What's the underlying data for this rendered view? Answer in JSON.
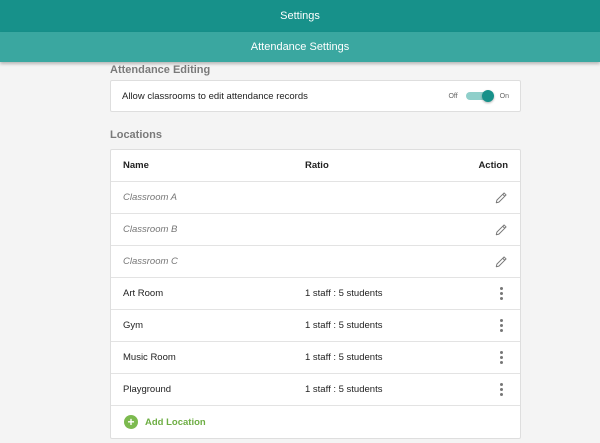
{
  "header": {
    "title": "Settings"
  },
  "subheader": {
    "title": "Attendance Settings"
  },
  "attendance_editing": {
    "section_title": "Attendance Editing",
    "label": "Allow classrooms to edit attendance records",
    "toggle_off_label": "Off",
    "toggle_on_label": "On",
    "enabled": true
  },
  "locations": {
    "section_title": "Locations",
    "columns": {
      "name": "Name",
      "ratio": "Ratio",
      "action": "Action"
    },
    "rows": [
      {
        "name": "Classroom A",
        "ratio": "",
        "action_icon": "pencil-icon"
      },
      {
        "name": "Classroom B",
        "ratio": "",
        "action_icon": "pencil-icon"
      },
      {
        "name": "Classroom C",
        "ratio": "",
        "action_icon": "pencil-icon"
      },
      {
        "name": "Art Room",
        "ratio": "1 staff : 5 students",
        "action_icon": "more-vertical-icon"
      },
      {
        "name": "Gym",
        "ratio": "1 staff : 5 students",
        "action_icon": "more-vertical-icon"
      },
      {
        "name": "Music Room",
        "ratio": "1 staff : 5 students",
        "action_icon": "more-vertical-icon"
      },
      {
        "name": "Playground",
        "ratio": "1 staff : 5 students",
        "action_icon": "more-vertical-icon"
      }
    ],
    "add_label": "Add Location"
  },
  "colors": {
    "header": "#17918a",
    "subheader": "#3aa7a0",
    "toggle": "#17918a",
    "add_accent": "#7cba4f"
  }
}
